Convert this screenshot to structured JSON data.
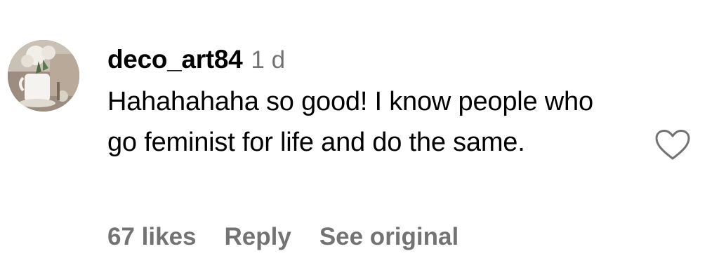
{
  "comment": {
    "username": "deco_art84",
    "timestamp": "1 d",
    "text": "Hahahahaha so good! I know people who go feminist for life and do the same.",
    "likes_label": "67 likes",
    "reply_label": "Reply",
    "see_original_label": "See original",
    "like_icon": "heart-outline-icon"
  },
  "colors": {
    "text_primary": "#000000",
    "text_secondary": "#737373",
    "icon_stroke": "#737373"
  }
}
